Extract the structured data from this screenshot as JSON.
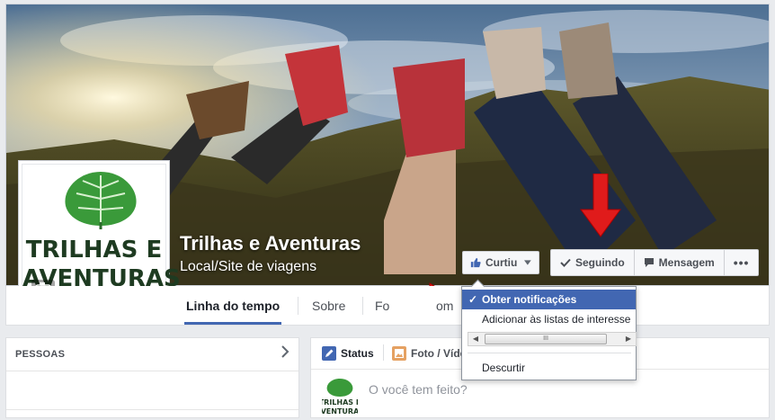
{
  "page": {
    "name": "Trilhas e Aventuras",
    "category": "Local/Site de viagens"
  },
  "logo": {
    "line1": "TRILHAS E",
    "line2": "AVENTURAS",
    "leaf_color": "#3a9a3a",
    "text_color": "#1e3b21"
  },
  "actions": {
    "curtiu": "Curtiu",
    "seguindo": "Seguindo",
    "mensagem": "Mensagem",
    "more": "•••"
  },
  "tabs": {
    "timeline": "Linha do tempo",
    "about": "Sobre",
    "photos_partial": "Fo",
    "more_partial": "om"
  },
  "dropdown": {
    "notifications": "Obter notificações",
    "add_to_lists": "Adicionar às listas de interesse",
    "scroll_thumb": "III",
    "unlike": "Descurtir"
  },
  "people": {
    "title": "PESSOAS"
  },
  "composer": {
    "status": "Status",
    "photo": "Foto / Víde",
    "placeholder": "O você tem feito?"
  },
  "colors": {
    "fb_blue": "#4267b2",
    "arrow_red": "#e01b1b"
  }
}
